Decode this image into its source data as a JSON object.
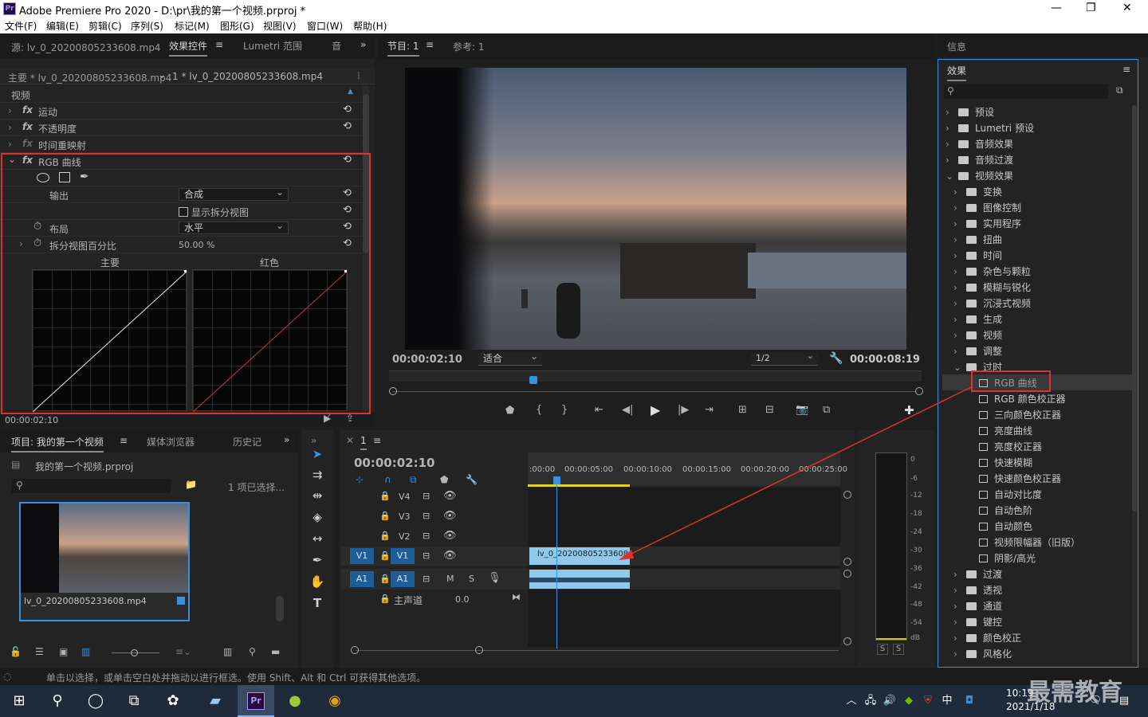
{
  "window": {
    "title": "Adobe Premiere Pro 2020 - D:\\pr\\我的第一个视频.prproj *",
    "logo": "Pr",
    "controls": [
      "—",
      "❐",
      "✕"
    ]
  },
  "menu": [
    "文件(F)",
    "编辑(E)",
    "剪辑(C)",
    "序列(S)",
    "标记(M)",
    "图形(G)",
    "视图(V)",
    "窗口(W)",
    "帮助(H)"
  ],
  "left_top": {
    "tabs": {
      "source": "源: lv_0_20200805233608.mp4",
      "effect_controls": "效果控件",
      "lumetri": "Lumetri 范围",
      "audio": "音"
    },
    "master_clip": "主要 * lv_0_20200805233608.mp4",
    "seq_clip": "1 * lv_0_20200805233608.mp4",
    "section_video": "视频",
    "effects": [
      {
        "label": "运动"
      },
      {
        "label": "不透明度"
      },
      {
        "label": "时间重映射"
      },
      {
        "label": "RGB 曲线"
      }
    ],
    "output_label": "输出",
    "output_value": "合成",
    "split_view_label": "显示拆分视图",
    "layout_label": "布局",
    "layout_value": "水平",
    "split_pct_label": "拆分视图百分比",
    "split_pct_value": "50.00 %",
    "curve_master": "主要",
    "curve_red": "红色",
    "timecode": "00:00:02:10"
  },
  "program": {
    "tab": "节目: 1",
    "ref_tab": "参考: 1",
    "timecode": "00:00:02:10",
    "fit": "适合",
    "quality": "1/2",
    "duration": "00:00:08:19"
  },
  "project": {
    "tab": "项目: 我的第一个视频",
    "media_tab": "媒体浏览器",
    "history_tab": "历史记",
    "file": "我的第一个视频.prproj",
    "selected": "1 项已选择...",
    "clip_name": "lv_0_20200805233608.mp4"
  },
  "timeline": {
    "tab": "1",
    "timecode": "00:00:02:10",
    "ruler": [
      ":00:00",
      "00:00:05:00",
      "00:00:10:00",
      "00:00:15:00",
      "00:00:20:00",
      "00:00:25:00"
    ],
    "tracks": [
      "V4",
      "V3",
      "V2",
      "V1",
      "A1"
    ],
    "master": "主声道",
    "master_val": "0.0",
    "clip_label": "lv_0_20200805233608"
  },
  "meter": {
    "labels": [
      "0",
      "-6",
      "-12",
      "-18",
      "-24",
      "-30",
      "-36",
      "-42",
      "-48",
      "-54",
      "dB"
    ],
    "solo": [
      "S",
      "S"
    ]
  },
  "right": {
    "info_tab": "信息",
    "effects_tab": "效果",
    "tree": [
      {
        "label": "预设",
        "level": 0,
        "type": "folder",
        "open": false
      },
      {
        "label": "Lumetri 预设",
        "level": 0,
        "type": "folder",
        "open": false
      },
      {
        "label": "音频效果",
        "level": 0,
        "type": "folder",
        "open": false
      },
      {
        "label": "音频过渡",
        "level": 0,
        "type": "folder",
        "open": false
      },
      {
        "label": "视频效果",
        "level": 0,
        "type": "folder",
        "open": true
      },
      {
        "label": "变换",
        "level": 1,
        "type": "folder",
        "open": false
      },
      {
        "label": "图像控制",
        "level": 1,
        "type": "folder",
        "open": false
      },
      {
        "label": "实用程序",
        "level": 1,
        "type": "folder",
        "open": false
      },
      {
        "label": "扭曲",
        "level": 1,
        "type": "folder",
        "open": false
      },
      {
        "label": "时间",
        "level": 1,
        "type": "folder",
        "open": false
      },
      {
        "label": "杂色与颗粒",
        "level": 1,
        "type": "folder",
        "open": false
      },
      {
        "label": "模糊与锐化",
        "level": 1,
        "type": "folder",
        "open": false
      },
      {
        "label": "沉浸式视频",
        "level": 1,
        "type": "folder",
        "open": false
      },
      {
        "label": "生成",
        "level": 1,
        "type": "folder",
        "open": false
      },
      {
        "label": "视频",
        "level": 1,
        "type": "folder",
        "open": false
      },
      {
        "label": "调整",
        "level": 1,
        "type": "folder",
        "open": false
      },
      {
        "label": "过时",
        "level": 1,
        "type": "folder",
        "open": true
      },
      {
        "label": "RGB 曲线",
        "level": 2,
        "type": "fx",
        "selected": true
      },
      {
        "label": "RGB 颜色校正器",
        "level": 2,
        "type": "fx"
      },
      {
        "label": "三向颜色校正器",
        "level": 2,
        "type": "fx"
      },
      {
        "label": "亮度曲线",
        "level": 2,
        "type": "fx"
      },
      {
        "label": "亮度校正器",
        "level": 2,
        "type": "fx"
      },
      {
        "label": "快速模糊",
        "level": 2,
        "type": "fx"
      },
      {
        "label": "快速颜色校正器",
        "level": 2,
        "type": "fx"
      },
      {
        "label": "自动对比度",
        "level": 2,
        "type": "fx"
      },
      {
        "label": "自动色阶",
        "level": 2,
        "type": "fx"
      },
      {
        "label": "自动颜色",
        "level": 2,
        "type": "fx"
      },
      {
        "label": "视频限幅器（旧版）",
        "level": 2,
        "type": "fx"
      },
      {
        "label": "阴影/高光",
        "level": 2,
        "type": "fx"
      },
      {
        "label": "过渡",
        "level": 1,
        "type": "folder",
        "open": false
      },
      {
        "label": "透视",
        "level": 1,
        "type": "folder",
        "open": false
      },
      {
        "label": "通道",
        "level": 1,
        "type": "folder",
        "open": false
      },
      {
        "label": "键控",
        "level": 1,
        "type": "folder",
        "open": false
      },
      {
        "label": "颜色校正",
        "level": 1,
        "type": "folder",
        "open": false
      },
      {
        "label": "风格化",
        "level": 1,
        "type": "folder",
        "open": false
      }
    ]
  },
  "status": "单击以选择，或单击空白处并拖动以进行框选。使用 Shift、Alt 和 Ctrl 可获得其他选项。",
  "taskbar": {
    "time": "10:19",
    "date": "2021/1/18",
    "ime": "中",
    "watermark": "最需教育"
  },
  "colors": {
    "accent": "#3b8fe0",
    "highlight": "#e03030",
    "selection": "#1f5d99"
  }
}
